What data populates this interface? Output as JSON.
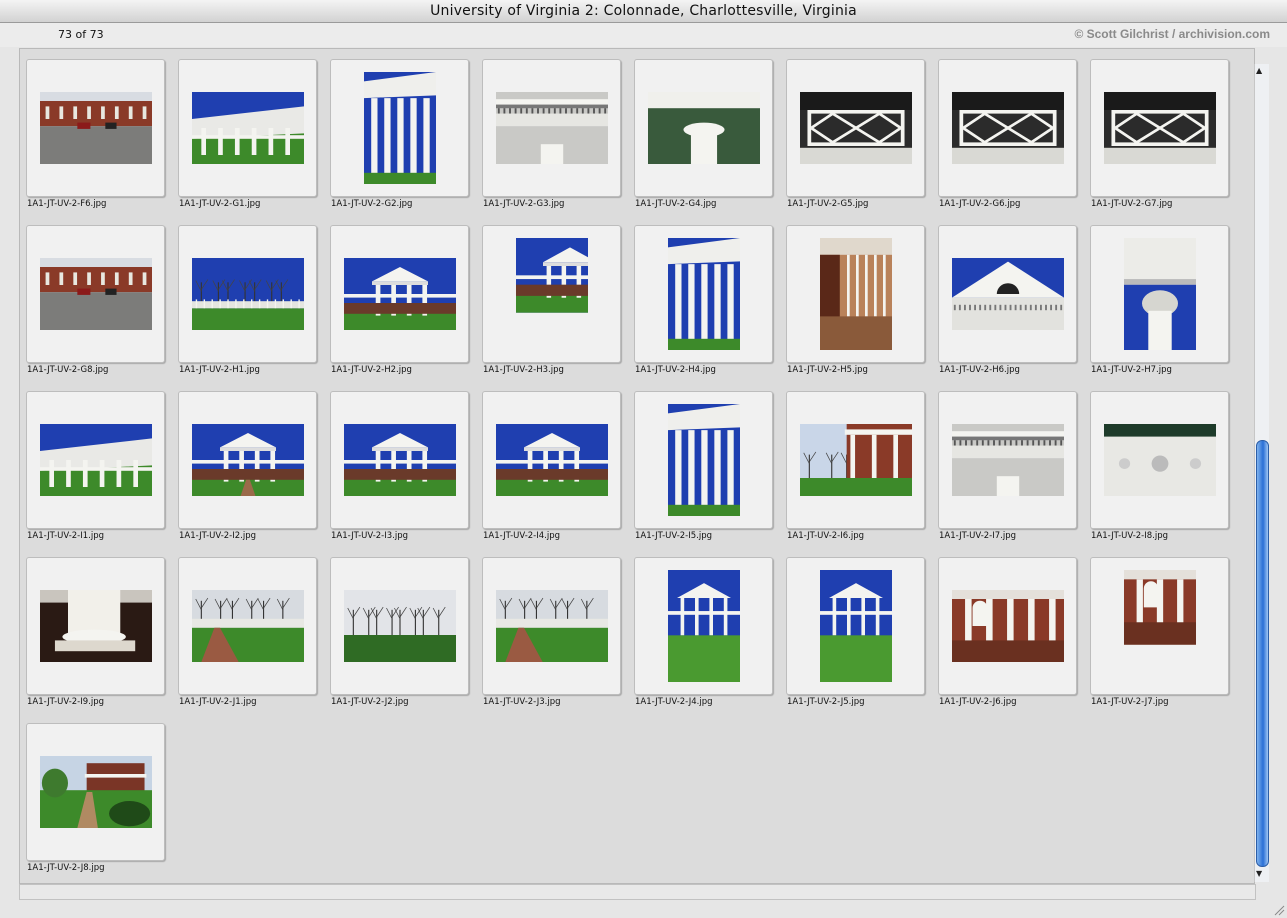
{
  "window": {
    "title": "University of Virginia 2: Colonnade, Charlottesville, Virginia"
  },
  "header": {
    "count": "73 of 73",
    "credit": "© Scott Gilchrist / archivision.com"
  },
  "thumbnails": [
    {
      "filename": "1A1-JT-UV-2-F6.jpg",
      "orientation": "landscape",
      "scene": "parking"
    },
    {
      "filename": "1A1-JT-UV-2-G1.jpg",
      "orientation": "landscape",
      "scene": "colonnade"
    },
    {
      "filename": "1A1-JT-UV-2-G2.jpg",
      "orientation": "portrait",
      "scene": "columns"
    },
    {
      "filename": "1A1-JT-UV-2-G3.jpg",
      "orientation": "landscape",
      "scene": "cornice"
    },
    {
      "filename": "1A1-JT-UV-2-G4.jpg",
      "orientation": "landscape",
      "scene": "capital"
    },
    {
      "filename": "1A1-JT-UV-2-G5.jpg",
      "orientation": "landscape",
      "scene": "railing"
    },
    {
      "filename": "1A1-JT-UV-2-G6.jpg",
      "orientation": "landscape",
      "scene": "railing"
    },
    {
      "filename": "1A1-JT-UV-2-G7.jpg",
      "orientation": "landscape",
      "scene": "railing"
    },
    {
      "filename": "1A1-JT-UV-2-G8.jpg",
      "orientation": "landscape",
      "scene": "parking"
    },
    {
      "filename": "1A1-JT-UV-2-H1.jpg",
      "orientation": "landscape",
      "scene": "lawn"
    },
    {
      "filename": "1A1-JT-UV-2-H2.jpg",
      "orientation": "landscape",
      "scene": "pavilion"
    },
    {
      "filename": "1A1-JT-UV-2-H3.jpg",
      "orientation": "portrait",
      "scene": "pavilion"
    },
    {
      "filename": "1A1-JT-UV-2-H4.jpg",
      "orientation": "portrait",
      "scene": "columns"
    },
    {
      "filename": "1A1-JT-UV-2-H5.jpg",
      "orientation": "portrait",
      "scene": "walkway"
    },
    {
      "filename": "1A1-JT-UV-2-H6.jpg",
      "orientation": "landscape",
      "scene": "pediment"
    },
    {
      "filename": "1A1-JT-UV-2-H7.jpg",
      "orientation": "portrait",
      "scene": "corinthian"
    },
    {
      "filename": "1A1-JT-UV-2-I1.jpg",
      "orientation": "landscape",
      "scene": "colonnade"
    },
    {
      "filename": "1A1-JT-UV-2-I2.jpg",
      "orientation": "landscape",
      "scene": "pavilion-path"
    },
    {
      "filename": "1A1-JT-UV-2-I3.jpg",
      "orientation": "landscape",
      "scene": "pavilion"
    },
    {
      "filename": "1A1-JT-UV-2-I4.jpg",
      "orientation": "landscape",
      "scene": "pavilion"
    },
    {
      "filename": "1A1-JT-UV-2-I5.jpg",
      "orientation": "portrait",
      "scene": "columns"
    },
    {
      "filename": "1A1-JT-UV-2-I6.jpg",
      "orientation": "landscape",
      "scene": "trees"
    },
    {
      "filename": "1A1-JT-UV-2-I7.jpg",
      "orientation": "landscape",
      "scene": "cornice"
    },
    {
      "filename": "1A1-JT-UV-2-I8.jpg",
      "orientation": "landscape",
      "scene": "frieze"
    },
    {
      "filename": "1A1-JT-UV-2-I9.jpg",
      "orientation": "landscape",
      "scene": "column-base"
    },
    {
      "filename": "1A1-JT-UV-2-J1.jpg",
      "orientation": "landscape",
      "scene": "lawn-path"
    },
    {
      "filename": "1A1-JT-UV-2-J2.jpg",
      "orientation": "landscape",
      "scene": "lawn-trees"
    },
    {
      "filename": "1A1-JT-UV-2-J3.jpg",
      "orientation": "landscape",
      "scene": "lawn-path"
    },
    {
      "filename": "1A1-JT-UV-2-J4.jpg",
      "orientation": "portrait",
      "scene": "pavilion-lawn"
    },
    {
      "filename": "1A1-JT-UV-2-J5.jpg",
      "orientation": "portrait",
      "scene": "pavilion-lawn"
    },
    {
      "filename": "1A1-JT-UV-2-J6.jpg",
      "orientation": "landscape",
      "scene": "arcade"
    },
    {
      "filename": "1A1-JT-UV-2-J7.jpg",
      "orientation": "portrait",
      "scene": "arcade"
    },
    {
      "filename": "1A1-JT-UV-2-J8.jpg",
      "orientation": "landscape",
      "scene": "garden"
    }
  ],
  "colors": {
    "sky": "#1f3fb0",
    "grass": "#3d8a2a",
    "brick": "#8a3a28",
    "white": "#f4f4f0",
    "shadow": "#2a2a2a",
    "scroll": "#2a6fd6"
  },
  "icons": {
    "scroll_up": "up-arrow-icon",
    "scroll_down": "down-arrow-icon",
    "resize": "resize-grip-icon"
  }
}
